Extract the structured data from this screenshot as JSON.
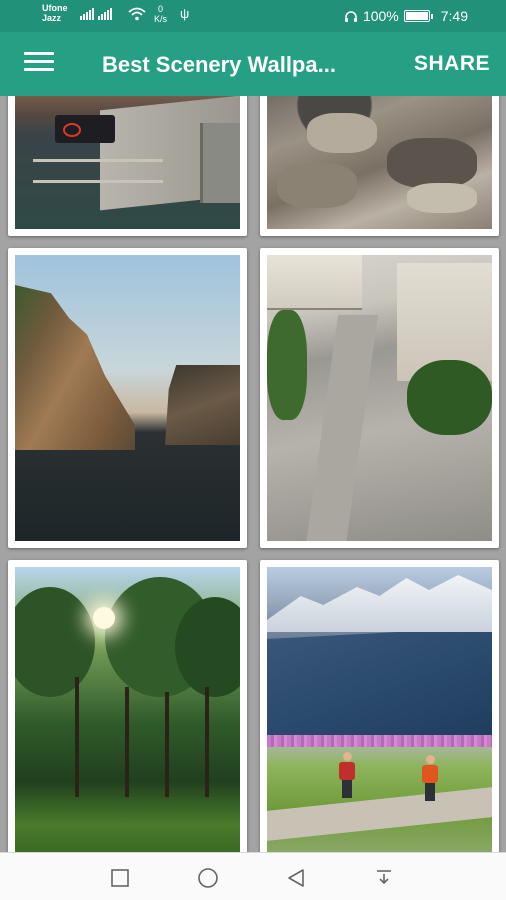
{
  "status_bar": {
    "carrier_line1": "Ufone",
    "carrier_line2": "Jazz",
    "net_speed_value": "0",
    "net_speed_unit": "K/s",
    "battery_text": "100%",
    "time": "7:49",
    "battery_level": 1.0
  },
  "app_bar": {
    "menu_icon": "hamburger-menu-icon",
    "title": "Best Scenery Wallpa...",
    "share_label": "SHARE",
    "color": "#26a085"
  },
  "grid": {
    "items": [
      {
        "subject": "canal-lock"
      },
      {
        "subject": "rocky-terrain"
      },
      {
        "subject": "river-cliffs"
      },
      {
        "subject": "city-square"
      },
      {
        "subject": "park-trees"
      },
      {
        "subject": "mountain-hikers"
      }
    ]
  },
  "nav_bar": {
    "icons": [
      "recent-apps-icon",
      "home-icon",
      "back-icon",
      "notification-pull-icon"
    ]
  }
}
